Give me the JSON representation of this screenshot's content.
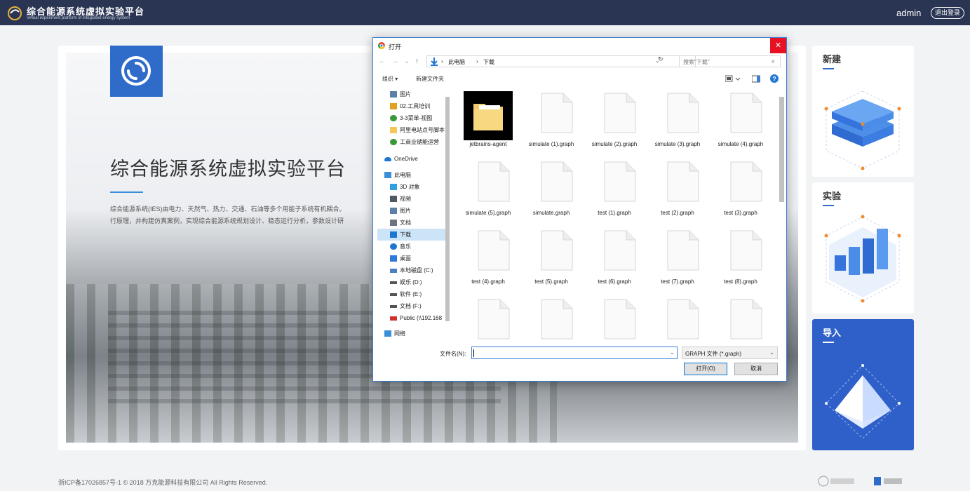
{
  "app": {
    "title": "综合能源系统虚拟实验平台",
    "subtitle": "Virtual experiment platform of integrated energy system",
    "user": "admin",
    "logout_label": "退出登录"
  },
  "hero": {
    "title": "综合能源系统虚拟实验平台",
    "desc_line1": "综合能源系统(IES)由电力、天然气、热力、交通、石油等多个用能子系统有机耦合。",
    "desc_line2": "行原理，并构建仿真案例，实现综合能源系统规划设计、稳态运行分析，参数设计研"
  },
  "panels": [
    {
      "label": "新建",
      "icon": "layers-illustration"
    },
    {
      "label": "实验",
      "icon": "bar-chart-illustration"
    },
    {
      "label": "导入",
      "icon": "pyramid-illustration"
    }
  ],
  "footer": {
    "copyright": "浙ICP备17026857号-1 © 2018 万克能源科技有限公司 All Rights Reserved."
  },
  "dialog": {
    "title": "打开",
    "breadcrumb": [
      "此电脑",
      "下载"
    ],
    "search_placeholder": "搜索\"下载\"",
    "toolbar": {
      "organize": "组织 ▾",
      "new_folder": "新建文件夹"
    },
    "nav_items": [
      {
        "label": "图片",
        "icon": "pictures-icon",
        "color": "#5b7fa6"
      },
      {
        "label": "02.工具培训",
        "icon": "folder-warning-icon",
        "color": "#e0a020"
      },
      {
        "label": "3-3菜单-视图",
        "icon": "folder-sync-icon",
        "color": "#3a9a3a"
      },
      {
        "label": "阿里电站点号脚本",
        "icon": "folder-icon",
        "color": "#f5c75b"
      },
      {
        "label": "工商业储能运营",
        "icon": "folder-sync-icon",
        "color": "#3a9a3a"
      },
      {
        "label": "OneDrive",
        "icon": "cloud-icon",
        "color": "#1e76d2"
      },
      {
        "label": "此电脑",
        "icon": "computer-icon",
        "color": "#3b8fd6"
      },
      {
        "label": "3D 对象",
        "icon": "3d-objects-icon",
        "color": "#2fa0e0"
      },
      {
        "label": "视频",
        "icon": "video-icon",
        "color": "#505a66"
      },
      {
        "label": "图片",
        "icon": "pictures-icon",
        "color": "#5b7fa6"
      },
      {
        "label": "文档",
        "icon": "documents-icon",
        "color": "#6d7680"
      },
      {
        "label": "下载",
        "icon": "download-icon",
        "color": "#1e76d2"
      },
      {
        "label": "音乐",
        "icon": "music-icon",
        "color": "#1e76d2"
      },
      {
        "label": "桌面",
        "icon": "desktop-icon",
        "color": "#2f7ad8"
      },
      {
        "label": "本地磁盘 (C:)",
        "icon": "drive-c-icon",
        "color": "#4a7fc0"
      },
      {
        "label": "娱乐 (D:)",
        "icon": "drive-icon",
        "color": "#555555"
      },
      {
        "label": "软件 (E:)",
        "icon": "drive-icon",
        "color": "#555555"
      },
      {
        "label": "文档 (F:)",
        "icon": "drive-icon",
        "color": "#555555"
      },
      {
        "label": "Public (\\\\192.168",
        "icon": "network-drive-icon",
        "color": "#d03030"
      },
      {
        "label": "网络",
        "icon": "network-icon",
        "color": "#3b8fd6"
      }
    ],
    "selected_nav_index": 11,
    "files": [
      "jetbrains-agent",
      "simulate (1).graph",
      "simulate (2).graph",
      "simulate (3).graph",
      "simulate (4).graph",
      "simulate (5).graph",
      "simulate.graph",
      "test (1).graph",
      "test (2).graph",
      "test (3).graph",
      "test (4).graph",
      "test (5).graph",
      "test (6).graph",
      "test (7).graph",
      "test (8).graph",
      "",
      "",
      "",
      "",
      ""
    ],
    "filename_label": "文件名(N):",
    "filename_value": "",
    "filetype": "GRAPH 文件 (*.graph)",
    "open_label": "打开(O)",
    "cancel_label": "取消"
  }
}
